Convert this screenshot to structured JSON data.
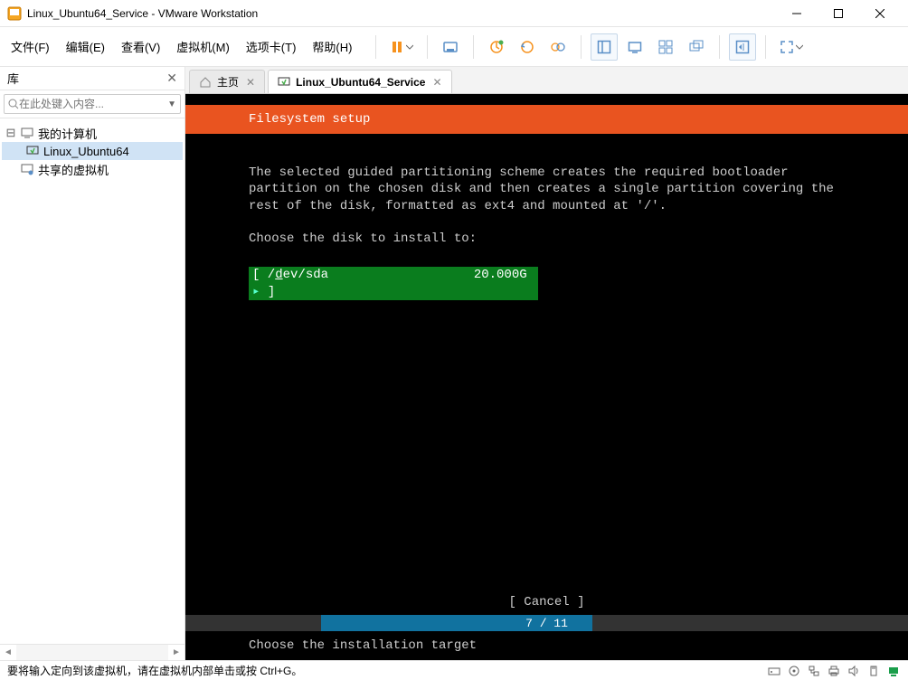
{
  "window": {
    "title": "Linux_Ubuntu64_Service - VMware Workstation"
  },
  "menu": {
    "file": "文件(F)",
    "edit": "编辑(E)",
    "view": "查看(V)",
    "vm": "虚拟机(M)",
    "tabs": "选项卡(T)",
    "help": "帮助(H)"
  },
  "sidebar": {
    "title": "库",
    "search_placeholder": "在此处键入内容...",
    "items": [
      {
        "label": "我的计算机",
        "icon": "monitor"
      },
      {
        "label": "Linux_Ubuntu64",
        "icon": "vm",
        "selected": true
      },
      {
        "label": "共享的虚拟机",
        "icon": "shared"
      }
    ]
  },
  "tabs": {
    "home": "主页",
    "vm": "Linux_Ubuntu64_Service"
  },
  "installer": {
    "header": "Filesystem setup",
    "body_line1": "The selected guided partitioning scheme creates the required bootloader",
    "body_line2": "partition on the chosen disk and then creates a single partition covering the",
    "body_line3": "rest of the disk, formatted as ext4 and mounted at '/'.",
    "choose": "Choose the disk to install to:",
    "disk_prefix": "[ /",
    "disk_underline": "d",
    "disk_suffix": "ev/sda",
    "disk_size": "20.000G",
    "disk_arrow": "▸",
    "disk_close": " ]",
    "cancel": "[ Cancel       ]",
    "progress": "7 / 11",
    "hint": "Choose the installation target"
  },
  "statusbar": {
    "msg": "要将输入定向到该虚拟机，请在虚拟机内部单击或按 Ctrl+G。"
  }
}
